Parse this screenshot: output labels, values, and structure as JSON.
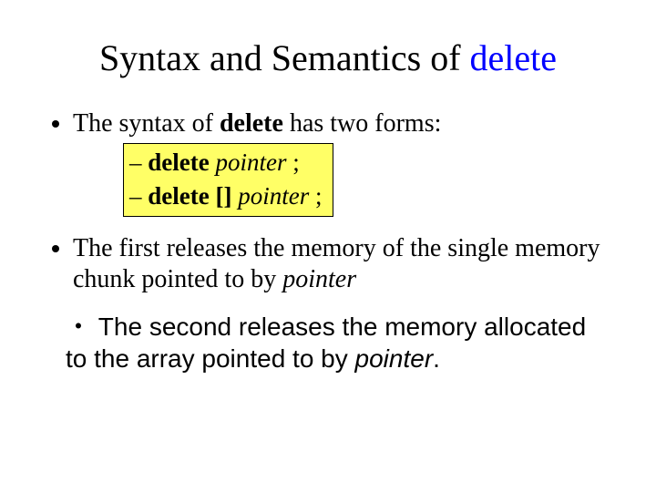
{
  "title": {
    "prefix": "Syntax and Semantics of ",
    "keyword": "delete"
  },
  "bullet1": {
    "lead": "The syntax of ",
    "kw": "delete",
    "tail": " has two forms:"
  },
  "forms": {
    "row1": {
      "dash": "– ",
      "kw": "delete",
      "sp": " ",
      "var": "pointer",
      "end": " ;"
    },
    "row2": {
      "dash": "– ",
      "kw": "delete []",
      "sp": " ",
      "var": "pointer",
      "end": " ;"
    }
  },
  "bullet2": {
    "part1": "The first releases the memory of the single memory chunk pointed to by ",
    "var": "pointer"
  },
  "bullet3": {
    "dot": "・",
    "part1": " The second releases the memory allocated to the array pointed to by ",
    "var": "pointer",
    "end": "."
  }
}
